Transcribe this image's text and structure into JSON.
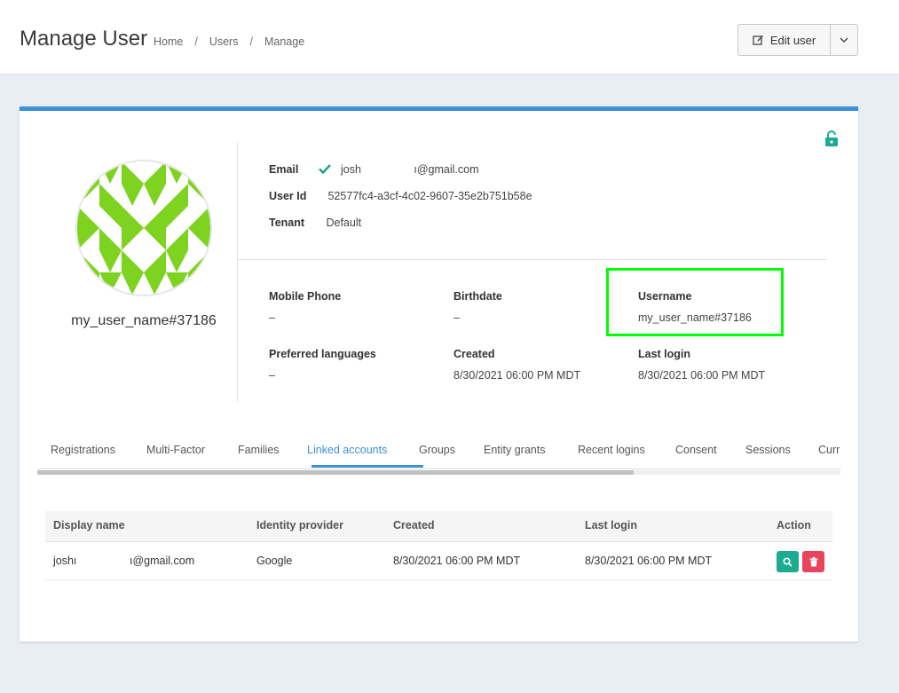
{
  "header": {
    "title": "Manage User",
    "breadcrumb": [
      "Home",
      "Users",
      "Manage"
    ],
    "breadcrumb_sep": "/",
    "edit_button_label": "Edit user"
  },
  "profile": {
    "display_name": "my_user_name#37186",
    "email_label": "Email",
    "email_part1": "josh",
    "email_part2": "ı@gmail.com",
    "user_id_label": "User Id",
    "user_id": "52577fc4-a3cf-4c02-9607-35e2b751b58e",
    "tenant_label": "Tenant",
    "tenant": "Default"
  },
  "details": {
    "mobile_phone_label": "Mobile Phone",
    "mobile_phone": "–",
    "birthdate_label": "Birthdate",
    "birthdate": "–",
    "username_label": "Username",
    "username": "my_user_name#37186",
    "preferred_languages_label": "Preferred languages",
    "preferred_languages": "–",
    "created_label": "Created",
    "created": "8/30/2021 06:00 PM MDT",
    "last_login_label": "Last login",
    "last_login": "8/30/2021 06:00 PM MDT"
  },
  "tabs": [
    "Registrations",
    "Multi-Factor",
    "Families",
    "Linked accounts",
    "Groups",
    "Entity grants",
    "Recent logins",
    "Consent",
    "Sessions",
    "Curr"
  ],
  "active_tab": "Linked accounts",
  "linked_table": {
    "columns": [
      "Display name",
      "Identity provider",
      "Created",
      "Last login",
      "Action"
    ],
    "rows": [
      {
        "display_name_part1": "joshı",
        "display_name_part2": "ı@gmail.com",
        "identity_provider": "Google",
        "created": "8/30/2021 06:00 PM MDT",
        "last_login": "8/30/2021 06:00 PM MDT"
      }
    ]
  },
  "colors": {
    "accent": "#3b91d6",
    "avatar_green": "#7ed321",
    "highlight": "#00ff00",
    "verified_check": "#1f9e89",
    "search_button": "#1cab91",
    "delete_button": "#e8455c"
  },
  "icons": [
    "edit-icon",
    "chevron-down-icon",
    "unlock-icon",
    "check-icon",
    "search-icon",
    "trash-icon"
  ]
}
